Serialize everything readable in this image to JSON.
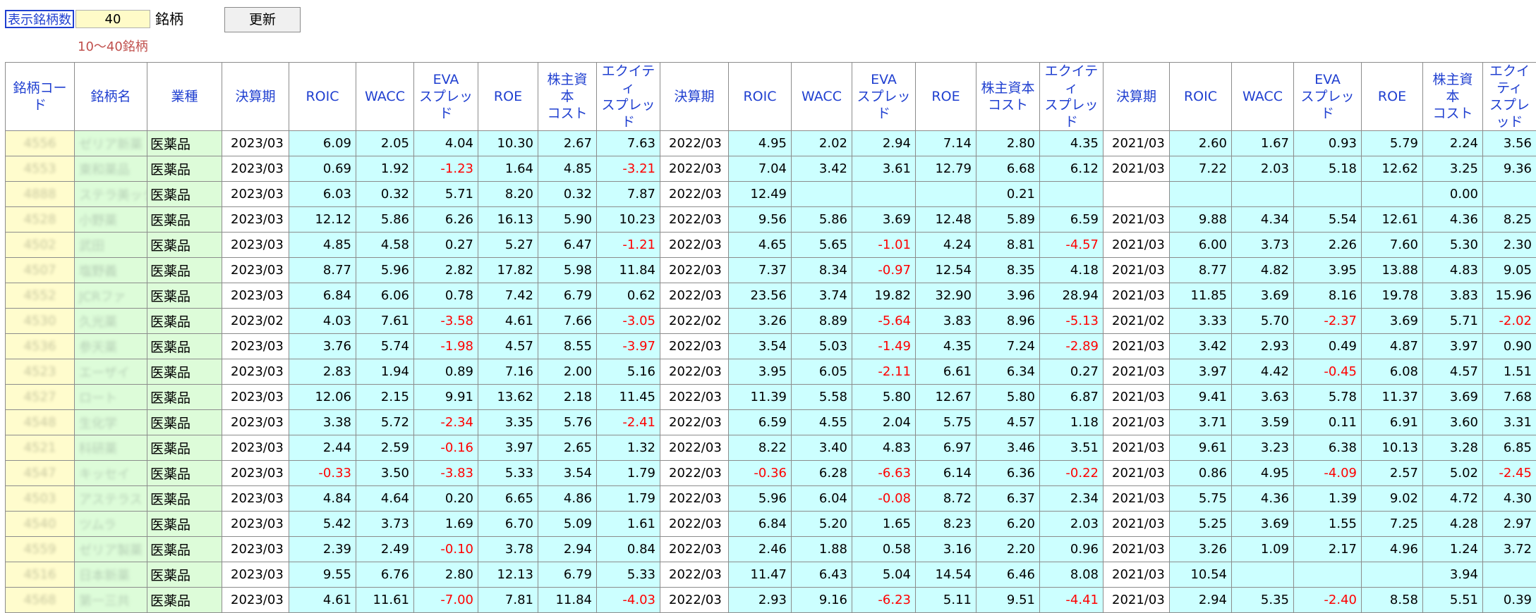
{
  "controls": {
    "count_label": "表示銘柄数",
    "count_value": "40",
    "count_unit": "銘柄",
    "update_button": "更新",
    "range_hint": "10～40銘柄"
  },
  "colors": {
    "header_text": "#1f3fd0",
    "data_bg": "#ccffff",
    "code_bg": "#fffccd",
    "name_bg": "#ddfcd9",
    "negative": "#ff0000"
  },
  "headers": [
    "銘柄コード",
    "銘柄名",
    "業種",
    "決算期",
    "ROIC",
    "WACC",
    "EVA\nスプレッド",
    "ROE",
    "株主資本\nコスト",
    "エクイティ\nスプレッド",
    "決算期",
    "ROIC",
    "WACC",
    "EVA\nスプレッド",
    "ROE",
    "株主資本\nコスト",
    "エクイティ\nスプレッド",
    "決算期",
    "ROIC",
    "WACC",
    "EVA\nスプレッド",
    "ROE",
    "株主資本\nコスト",
    "エクイティ\nスプレッド"
  ],
  "rows": [
    [
      "4556",
      "ゼリア新薬",
      "医薬品",
      "2023/03",
      "6.09",
      "2.05",
      "4.04",
      "10.30",
      "2.67",
      "7.63",
      "2022/03",
      "4.95",
      "2.02",
      "2.94",
      "7.14",
      "2.80",
      "4.35",
      "2021/03",
      "2.60",
      "1.67",
      "0.93",
      "5.79",
      "2.24",
      "3.56"
    ],
    [
      "4553",
      "東和薬品",
      "医薬品",
      "2023/03",
      "0.69",
      "1.92",
      "-1.23",
      "1.64",
      "4.85",
      "-3.21",
      "2022/03",
      "7.04",
      "3.42",
      "3.61",
      "12.79",
      "6.68",
      "6.12",
      "2021/03",
      "7.22",
      "2.03",
      "5.18",
      "12.62",
      "3.25",
      "9.36"
    ],
    [
      "4888",
      "ステラ美ックス",
      "医薬品",
      "2023/03",
      "6.03",
      "0.32",
      "5.71",
      "8.20",
      "0.32",
      "7.87",
      "2022/03",
      "12.49",
      "",
      "",
      "",
      "0.21",
      "",
      "",
      "",
      "",
      "",
      "",
      "0.00",
      ""
    ],
    [
      "4528",
      "小野薬",
      "医薬品",
      "2023/03",
      "12.12",
      "5.86",
      "6.26",
      "16.13",
      "5.90",
      "10.23",
      "2022/03",
      "9.56",
      "5.86",
      "3.69",
      "12.48",
      "5.89",
      "6.59",
      "2021/03",
      "9.88",
      "4.34",
      "5.54",
      "12.61",
      "4.36",
      "8.25"
    ],
    [
      "4502",
      "武田",
      "医薬品",
      "2023/03",
      "4.85",
      "4.58",
      "0.27",
      "5.27",
      "6.47",
      "-1.21",
      "2022/03",
      "4.65",
      "5.65",
      "-1.01",
      "4.24",
      "8.81",
      "-4.57",
      "2021/03",
      "6.00",
      "3.73",
      "2.26",
      "7.60",
      "5.30",
      "2.30"
    ],
    [
      "4507",
      "塩野義",
      "医薬品",
      "2023/03",
      "8.77",
      "5.96",
      "2.82",
      "17.82",
      "5.98",
      "11.84",
      "2022/03",
      "7.37",
      "8.34",
      "-0.97",
      "12.54",
      "8.35",
      "4.18",
      "2021/03",
      "8.77",
      "4.82",
      "3.95",
      "13.88",
      "4.83",
      "9.05"
    ],
    [
      "4552",
      "JCRファ",
      "医薬品",
      "2023/03",
      "6.84",
      "6.06",
      "0.78",
      "7.42",
      "6.79",
      "0.62",
      "2022/03",
      "23.56",
      "3.74",
      "19.82",
      "32.90",
      "3.96",
      "28.94",
      "2021/03",
      "11.85",
      "3.69",
      "8.16",
      "19.78",
      "3.83",
      "15.96"
    ],
    [
      "4530",
      "久光薬",
      "医薬品",
      "2023/02",
      "4.03",
      "7.61",
      "-3.58",
      "4.61",
      "7.66",
      "-3.05",
      "2022/02",
      "3.26",
      "8.89",
      "-5.64",
      "3.83",
      "8.96",
      "-5.13",
      "2021/02",
      "3.33",
      "5.70",
      "-2.37",
      "3.69",
      "5.71",
      "-2.02"
    ],
    [
      "4536",
      "参天薬",
      "医薬品",
      "2023/03",
      "3.76",
      "5.74",
      "-1.98",
      "4.57",
      "8.55",
      "-3.97",
      "2022/03",
      "3.54",
      "5.03",
      "-1.49",
      "4.35",
      "7.24",
      "-2.89",
      "2021/03",
      "3.42",
      "2.93",
      "0.49",
      "4.87",
      "3.97",
      "0.90"
    ],
    [
      "4523",
      "エーザイ",
      "医薬品",
      "2023/03",
      "2.83",
      "1.94",
      "0.89",
      "7.16",
      "2.00",
      "5.16",
      "2022/03",
      "3.95",
      "6.05",
      "-2.11",
      "6.61",
      "6.34",
      "0.27",
      "2021/03",
      "3.97",
      "4.42",
      "-0.45",
      "6.08",
      "4.57",
      "1.51"
    ],
    [
      "4527",
      "ロート",
      "医薬品",
      "2023/03",
      "12.06",
      "2.15",
      "9.91",
      "13.62",
      "2.18",
      "11.45",
      "2022/03",
      "11.39",
      "5.58",
      "5.80",
      "12.67",
      "5.80",
      "6.87",
      "2021/03",
      "9.41",
      "3.63",
      "5.78",
      "11.37",
      "3.69",
      "7.68"
    ],
    [
      "4548",
      "生化学",
      "医薬品",
      "2023/03",
      "3.38",
      "5.72",
      "-2.34",
      "3.35",
      "5.76",
      "-2.41",
      "2022/03",
      "6.59",
      "4.55",
      "2.04",
      "5.75",
      "4.57",
      "1.18",
      "2021/03",
      "3.71",
      "3.59",
      "0.11",
      "6.91",
      "3.60",
      "3.31"
    ],
    [
      "4521",
      "科研薬",
      "医薬品",
      "2023/03",
      "2.44",
      "2.59",
      "-0.16",
      "3.97",
      "2.65",
      "1.32",
      "2022/03",
      "8.22",
      "3.40",
      "4.83",
      "6.97",
      "3.46",
      "3.51",
      "2021/03",
      "9.61",
      "3.23",
      "6.38",
      "10.13",
      "3.28",
      "6.85"
    ],
    [
      "4547",
      "キッセイ",
      "医薬品",
      "2023/03",
      "-0.33",
      "3.50",
      "-3.83",
      "5.33",
      "3.54",
      "1.79",
      "2022/03",
      "-0.36",
      "6.28",
      "-6.63",
      "6.14",
      "6.36",
      "-0.22",
      "2021/03",
      "0.86",
      "4.95",
      "-4.09",
      "2.57",
      "5.02",
      "-2.45"
    ],
    [
      "4503",
      "アステラス",
      "医薬品",
      "2023/03",
      "4.84",
      "4.64",
      "0.20",
      "6.65",
      "4.86",
      "1.79",
      "2022/03",
      "5.96",
      "6.04",
      "-0.08",
      "8.72",
      "6.37",
      "2.34",
      "2021/03",
      "5.75",
      "4.36",
      "1.39",
      "9.02",
      "4.72",
      "4.30"
    ],
    [
      "4540",
      "ツムラ",
      "医薬品",
      "2023/03",
      "5.42",
      "3.73",
      "1.69",
      "6.70",
      "5.09",
      "1.61",
      "2022/03",
      "6.84",
      "5.20",
      "1.65",
      "8.23",
      "6.20",
      "2.03",
      "2021/03",
      "5.25",
      "3.69",
      "1.55",
      "7.25",
      "4.28",
      "2.97"
    ],
    [
      "4559",
      "ゼリア製薬",
      "医薬品",
      "2023/03",
      "2.39",
      "2.49",
      "-0.10",
      "3.78",
      "2.94",
      "0.84",
      "2022/03",
      "2.46",
      "1.88",
      "0.58",
      "3.16",
      "2.20",
      "0.96",
      "2021/03",
      "3.26",
      "1.09",
      "2.17",
      "4.96",
      "1.24",
      "3.72"
    ],
    [
      "4516",
      "日本新薬",
      "医薬品",
      "2023/03",
      "9.55",
      "6.76",
      "2.80",
      "12.13",
      "6.79",
      "5.33",
      "2022/03",
      "11.47",
      "6.43",
      "5.04",
      "14.54",
      "6.46",
      "8.08",
      "2021/03",
      "10.54",
      "",
      "",
      "",
      "3.94",
      ""
    ],
    [
      "4568",
      "第一三共",
      "医薬品",
      "2023/03",
      "4.61",
      "11.61",
      "-7.00",
      "7.81",
      "11.84",
      "-4.03",
      "2022/03",
      "2.93",
      "9.16",
      "-6.23",
      "5.11",
      "9.51",
      "-4.41",
      "2021/03",
      "2.94",
      "5.35",
      "-2.40",
      "8.58",
      "5.51",
      "0.39"
    ]
  ]
}
